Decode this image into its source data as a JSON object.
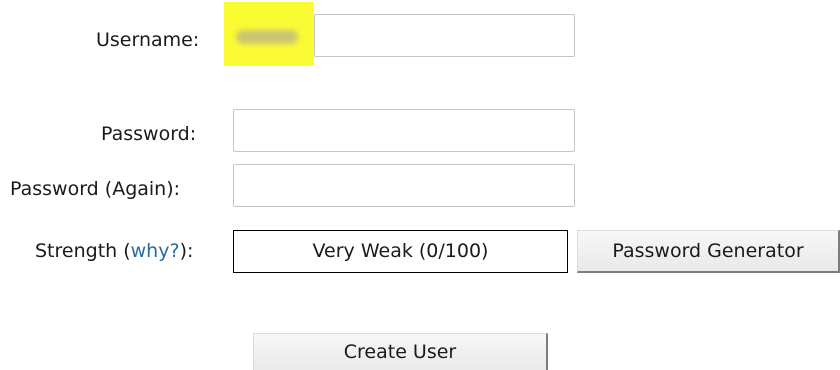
{
  "fields": {
    "username_label": "Username:",
    "password_label": "Password:",
    "password_again_label": "Password (Again):"
  },
  "strength": {
    "label_prefix": "Strength (",
    "why_link": "why?",
    "label_suffix": "):",
    "value_text": "Very Weak (0/100)"
  },
  "buttons": {
    "password_generator": "Password Generator",
    "create_user": "Create User"
  },
  "colors": {
    "highlight": "#fbfb33",
    "link": "#2a6aa0"
  }
}
